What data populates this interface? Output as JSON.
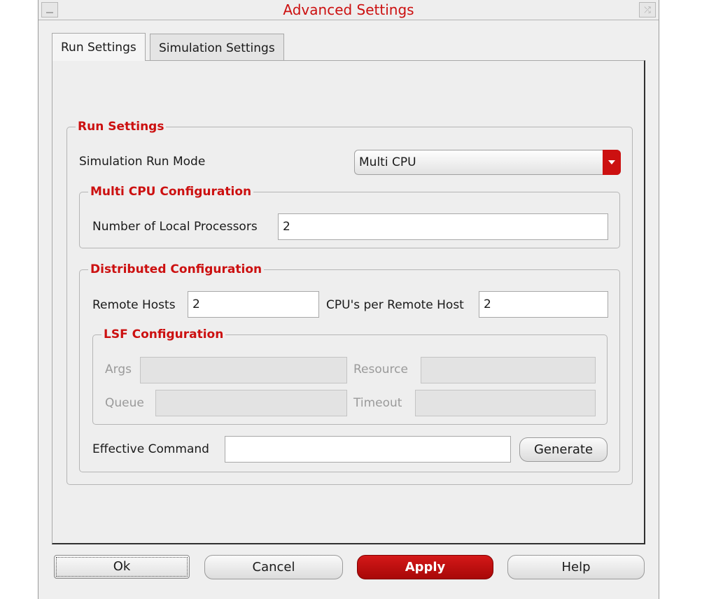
{
  "window": {
    "title": "Advanced Settings",
    "close_glyph": "⤮"
  },
  "tabs": [
    {
      "label": "Run Settings",
      "active": true
    },
    {
      "label": "Simulation Settings",
      "active": false
    }
  ],
  "run_settings": {
    "group_title": "Run Settings",
    "run_mode_label": "Simulation Run Mode",
    "run_mode_value": "Multi CPU",
    "multi_cpu": {
      "group_title": "Multi CPU Configuration",
      "local_processors_label": "Number of Local Processors",
      "local_processors_value": "2"
    },
    "distributed": {
      "group_title": "Distributed Configuration",
      "remote_hosts_label": "Remote Hosts",
      "remote_hosts_value": "2",
      "cpus_per_host_label": "CPU's per Remote Host",
      "cpus_per_host_value": "2",
      "lsf": {
        "group_title": "LSF Configuration",
        "args_label": "Args",
        "args_value": "",
        "resource_label": "Resource",
        "resource_value": "",
        "queue_label": "Queue",
        "queue_value": "",
        "timeout_label": "Timeout",
        "timeout_value": ""
      },
      "effective_command_label": "Effective Command",
      "effective_command_value": "",
      "generate_label": "Generate"
    }
  },
  "buttons": {
    "ok": "Ok",
    "cancel": "Cancel",
    "apply": "Apply",
    "help": "Help"
  },
  "colors": {
    "accent_red": "#cc1010",
    "window_bg": "#efefef"
  }
}
